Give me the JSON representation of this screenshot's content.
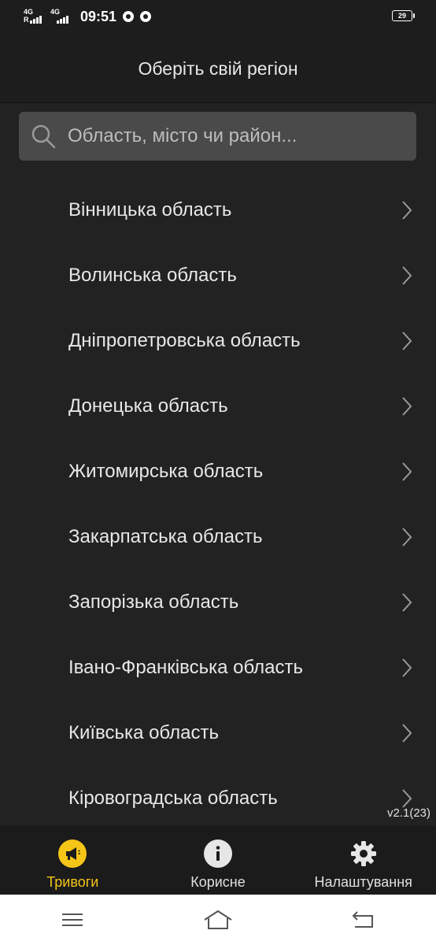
{
  "status_bar": {
    "time": "09:51",
    "network_label": "4G",
    "roaming_label": "R",
    "battery": "29"
  },
  "header": {
    "title": "Оберіть свій регіон"
  },
  "search": {
    "placeholder": "Область, місто чи район..."
  },
  "regions": [
    {
      "label": "Вінницька область"
    },
    {
      "label": "Волинська область"
    },
    {
      "label": "Дніпропетровська область"
    },
    {
      "label": "Донецька область"
    },
    {
      "label": "Житомирська область"
    },
    {
      "label": "Закарпатська область"
    },
    {
      "label": "Запорізька область"
    },
    {
      "label": "Івано-Франківська область"
    },
    {
      "label": "Київська область"
    },
    {
      "label": "Кіровоградська область"
    }
  ],
  "version": "v2.1(23)",
  "tabs": [
    {
      "label": "Тривоги",
      "icon": "megaphone-icon",
      "active": true
    },
    {
      "label": "Корисне",
      "icon": "info-icon",
      "active": false
    },
    {
      "label": "Налаштування",
      "icon": "gear-icon",
      "active": false
    }
  ],
  "colors": {
    "accent": "#f5c518",
    "background": "#222222",
    "bar": "#1b1b1b"
  }
}
